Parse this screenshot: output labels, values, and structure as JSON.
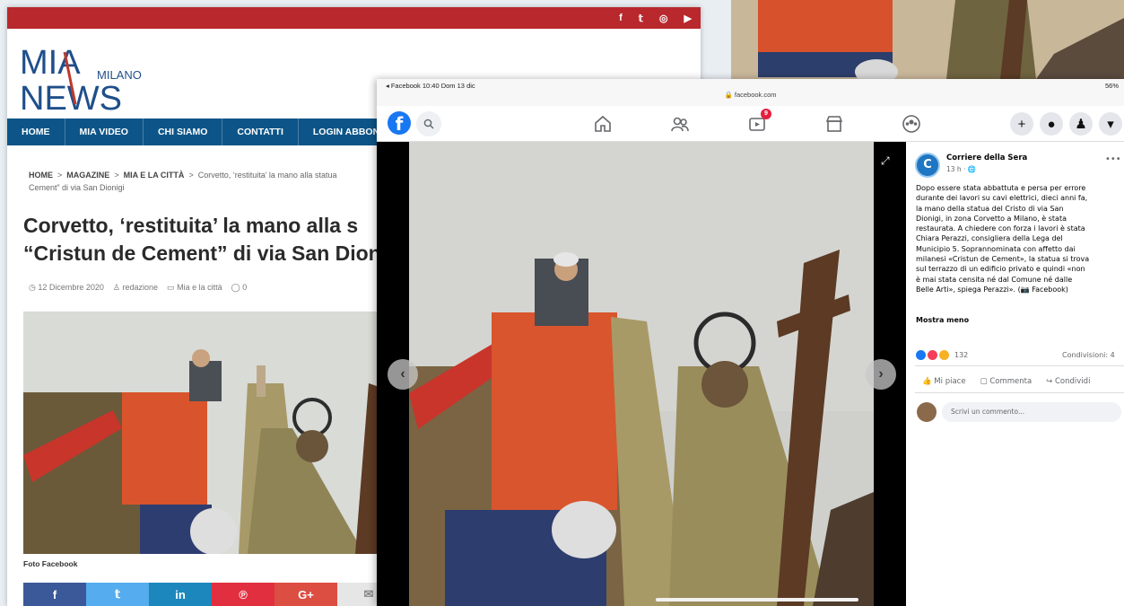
{
  "site": {
    "social": [
      "f",
      "𝕥",
      "◎",
      "▶"
    ],
    "logo": {
      "top": "MIA",
      "bottom": "NEWS",
      "city": "MILANO"
    },
    "nav": [
      "HOME",
      "MIA VIDEO",
      "CHI SIAMO",
      "CONTATTI",
      "LOGIN ABBONATI"
    ],
    "breadcrumb": {
      "home": "HOME",
      "sep": ">",
      "magazine": "MAGAZINE",
      "section": "MIA E LA CITTÀ",
      "current_line1": "Corvetto, ‘restituita’ la mano alla statua",
      "current_line2": "Cement” di via San Dionigi"
    },
    "title_line1": "Corvetto, ‘restituita’ la mano alla s",
    "title_line2": "“Cristun de Cement” di via San Dion",
    "meta": {
      "date": "12 Dicembre 2020",
      "author": "redazione",
      "category": "Mia e la città",
      "comments": "0"
    },
    "caption": "Foto Facebook",
    "share": [
      "f",
      "𝕥",
      "in",
      "℗",
      "G+",
      "✉"
    ]
  },
  "colors": {
    "site_red": "#b8282d",
    "site_nav": "#0d5588",
    "fb_blue": "#1877f2",
    "share_facebook": "#3b5998",
    "share_twitter": "#55acee",
    "share_linkedin": "#1c87bd",
    "share_pinterest": "#e12f3f",
    "share_google": "#dc4e41",
    "share_email": "#e6e6e6"
  },
  "fb": {
    "status": {
      "left": "◂ Facebook  10:40  Dom 13 dic",
      "url": "🔒 facebook.com",
      "right": "56%"
    },
    "logo": "f",
    "badge": "9",
    "post": {
      "avatar": "C",
      "page_name": "Corriere della Sera",
      "time": "13 h · 🌐",
      "more": "•••",
      "text": "Dopo essere stata abbattuta e persa per errore\ndurante dei lavori su cavi elettrici, dieci anni fa,\nla mano della statua del Cristo di via San\nDionigi, in zona Corvetto a Milano, è stata\nrestaurata. A chiedere con forza i lavori è stata\nChiara Perazzi, consigliera della Lega del\nMunicipio 5. Soprannominata con affetto dai\nmilanesi «Cristun de Cement», la statua si trova\nsul terrazzo di un edificio privato e quindi «non\nè mai stata censita né dal Comune né dalle\nBelle Arti», spiega Perazzi». (📷 Facebook)",
      "show_less": "Mostra meno",
      "reactions_count": "132",
      "shares": "Condivisioni: 4",
      "like": "Mi piace",
      "comment": "Commenta",
      "share": "Condividi",
      "comment_placeholder": "Scrivi un commento..."
    }
  }
}
